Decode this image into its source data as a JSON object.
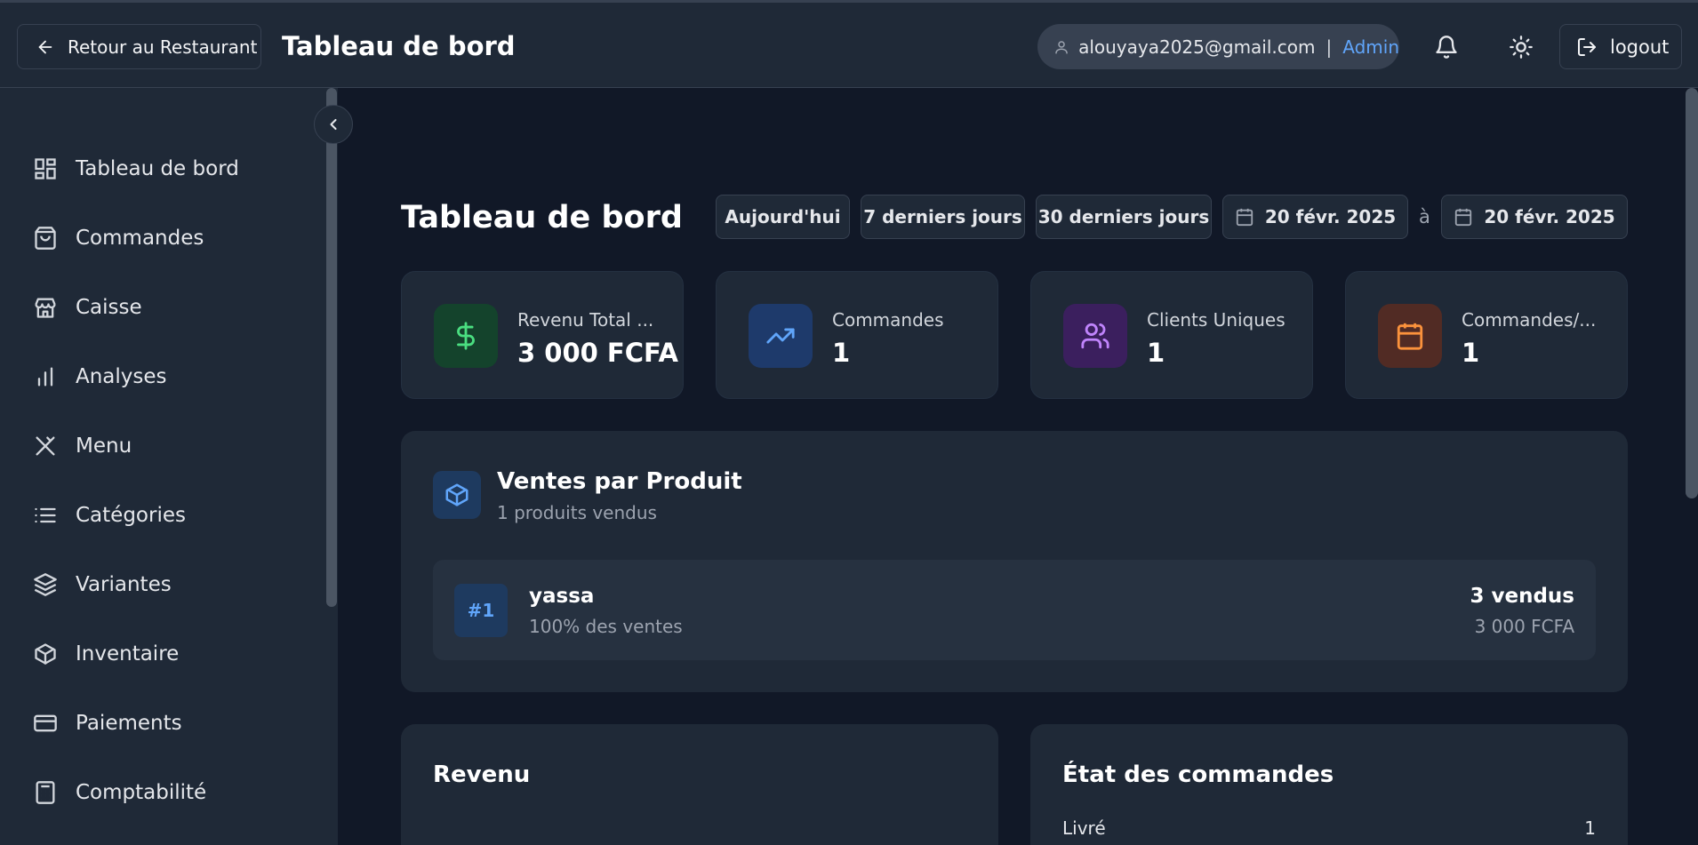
{
  "header": {
    "back_label": "Retour au Restaurant",
    "title": "Tableau de bord",
    "user_email": "alouyaya2025@gmail.com",
    "separator": "|",
    "user_role": "Admin",
    "logout_label": "logout"
  },
  "sidebar": {
    "items": [
      {
        "label": "Tableau de bord",
        "icon": "dashboard-icon"
      },
      {
        "label": "Commandes",
        "icon": "shopping-bag-icon"
      },
      {
        "label": "Caisse",
        "icon": "store-icon"
      },
      {
        "label": "Analyses",
        "icon": "bar-chart-icon"
      },
      {
        "label": "Menu",
        "icon": "utensils-icon"
      },
      {
        "label": "Catégories",
        "icon": "list-icon"
      },
      {
        "label": "Variantes",
        "icon": "layers-icon"
      },
      {
        "label": "Inventaire",
        "icon": "package-icon"
      },
      {
        "label": "Paiements",
        "icon": "credit-card-icon"
      },
      {
        "label": "Comptabilité",
        "icon": "calculator-icon"
      }
    ]
  },
  "main": {
    "title": "Tableau de bord",
    "filters": {
      "today": "Aujourd'hui",
      "last7": "7 derniers jours",
      "last30": "30 derniers jours",
      "date_from": "20 févr. 2025",
      "date_sep": "à",
      "date_to": "20 févr. 2025"
    },
    "stats": [
      {
        "label": "Revenu Total ...",
        "value": "3 000 FCFA",
        "color": "#4ade80"
      },
      {
        "label": "Commandes",
        "value": "1",
        "color": "#60a5fa"
      },
      {
        "label": "Clients Uniques",
        "value": "1",
        "color": "#c084fc"
      },
      {
        "label": "Commandes/...",
        "value": "1",
        "color": "#fb923c"
      }
    ],
    "sales": {
      "title": "Ventes par Produit",
      "subtitle": "1 produits vendus",
      "products": [
        {
          "rank": "#1",
          "name": "yassa",
          "share": "100% des ventes",
          "sold": "3 vendus",
          "amount": "3 000 FCFA"
        }
      ]
    },
    "revenue": {
      "title": "Revenu"
    },
    "order_status": {
      "title": "État des commandes",
      "rows": [
        {
          "label": "Livré",
          "count": "1"
        }
      ]
    }
  },
  "colors": {
    "accent": "#60a5fa",
    "bg": "#111827",
    "panel": "#1f2937"
  }
}
